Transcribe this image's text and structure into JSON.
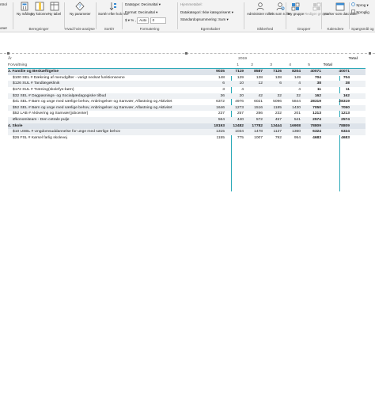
{
  "ribbon": {
    "calc_group": {
      "new_measure": "Ny måling",
      "new_column": "Ny kolonne",
      "new_table": "Ny tabel",
      "label": "Beregninger",
      "cut_left_top": "ntrol",
      "cut_left_bottom": "oner"
    },
    "whatif": {
      "button": "Ny parameter",
      "label": "Hvad hvis-analyse"
    },
    "sort": {
      "button": "Sortér efter kolonne",
      "label": "Sortér"
    },
    "format": {
      "datatype": "Datatype: Decimaltal",
      "format": "Format: Decimaltal",
      "currency": "$",
      "percent": "%",
      "comma": ",",
      "auto": "Auto",
      "decimals": "0",
      "label": "Formatering"
    },
    "props": {
      "home_table": "Hjemmetabel:",
      "data_category": "Datakategori: Ikke kategoriseret",
      "default_summary": "Standardopsummering: Sum",
      "label": "Egenskaber"
    },
    "security": {
      "manage_roles": "Administrer roller",
      "view_as": "Vis som roller",
      "label": "Sikkerhed"
    },
    "groups": {
      "new_group": "Ny gruppe",
      "edit_groups": "Rediger grupper",
      "label": "Grupper"
    },
    "calendars": {
      "mark_date": "Marker som datotabel",
      "label": "Kalendere"
    },
    "qa": {
      "language": "Sprog",
      "linguistic": "Sproglig",
      "label": "Spørgsmål og"
    }
  },
  "matrix": {
    "header": {
      "year_label": "År",
      "year_value": "2019",
      "total": "Total",
      "row_label": "Forvaltning",
      "quarters": [
        "1",
        "2",
        "3",
        "4",
        "5"
      ],
      "sub_total": "Total"
    },
    "rows": [
      {
        "label": "3. Familie og Beskæftigelse",
        "type": "cat",
        "values": [
          "9035",
          "7119",
          "8587",
          "7126",
          "8204",
          "40071",
          "40071"
        ]
      },
      {
        "label": "$100 SEL # Dækning af merudgifter - varigt nedsat funktionsevne",
        "type": "sub",
        "values": [
          "148",
          "129",
          "138",
          "138",
          "149",
          "704",
          "704"
        ]
      },
      {
        "label": "$126 SUL # Tandlægeklinik",
        "type": "sub",
        "values": [
          "6",
          "10",
          "12",
          "6",
          "4",
          "38",
          "38"
        ]
      },
      {
        "label": "$172 SUL # Træning(skolefys-børn)",
        "type": "sub",
        "values": [
          "3",
          "4",
          "",
          "",
          "4",
          "11",
          "11"
        ]
      },
      {
        "label": "$32 SEL # Dagpasnings- og Socialpædagogiske tilbud",
        "type": "sub",
        "values": [
          "36",
          "20",
          "42",
          "32",
          "32",
          "162",
          "162"
        ]
      },
      {
        "label": "$41 SEL # Børn og unge med særlige behov, Anbringelser og Samvær, Aflastning og Aktivitet",
        "type": "sub",
        "values": [
          "6372",
          "4976",
          "6021",
          "5096",
          "5844",
          "28319",
          "28319"
        ]
      },
      {
        "label": "$52 SEL # Børn og unge med særlige behov, Anbringelser og Samvær, Aflastning og Aktivitet",
        "type": "sub",
        "values": [
          "1646",
          "1273",
          "1516",
          "1185",
          "1430",
          "7050",
          "7050"
        ]
      },
      {
        "label": "$52 LAB # Aktivering og Samvær(jobcenter)",
        "type": "sub",
        "values": [
          "237",
          "257",
          "286",
          "232",
          "201",
          "1213",
          "1213"
        ]
      },
      {
        "label": "Økonomiteam - Den cetrale pulje",
        "type": "sub",
        "values": [
          "564",
          "440",
          "572",
          "457",
          "541",
          "2574",
          "2574"
        ]
      },
      {
        "label": "4. Skole",
        "type": "cat",
        "values": [
          "18193",
          "12482",
          "17782",
          "13444",
          "16908",
          "78809",
          "78809"
        ]
      },
      {
        "label": "$10 USBL # Ungdomsuddannelse for unge med særlige behov",
        "type": "sub",
        "values": [
          "1315",
          "1034",
          "1478",
          "1137",
          "1360",
          "6324",
          "6324"
        ]
      },
      {
        "label": "$26 FSL # Kørsel farlig skolevej",
        "type": "sub",
        "values": [
          "1155",
          "775",
          "1007",
          "792",
          "954",
          "4683",
          "4683"
        ]
      }
    ]
  }
}
